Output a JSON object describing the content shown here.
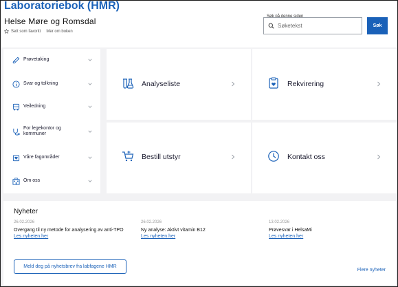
{
  "header": {
    "site_title": "Laboratoriebok (HMR)",
    "org_name": "Helse Møre og Romsdal",
    "favorite_label": "Sett som favoritt",
    "about_label": "Mer om boken"
  },
  "search": {
    "label": "Søk på denne siden",
    "placeholder": "Søketekst",
    "value": "",
    "button_label": "Søk"
  },
  "sidebar": {
    "items": [
      {
        "label": "Prøvetaking",
        "icon": "test-tube-icon"
      },
      {
        "label": "Svar og tolkning",
        "icon": "info-icon"
      },
      {
        "label": "Veiledning",
        "icon": "bus-icon"
      },
      {
        "label": "For legekontor og kommuner",
        "icon": "stethoscope-icon"
      },
      {
        "label": "Våre fagområder",
        "icon": "hand-heart-icon"
      },
      {
        "label": "Om oss",
        "icon": "building-icon"
      }
    ]
  },
  "cards": [
    {
      "label": "Analyseliste",
      "icon": "lab-flask-icon"
    },
    {
      "label": "Rekvirering",
      "icon": "requisition-icon"
    },
    {
      "label": "Bestill utstyr",
      "icon": "cart-icon"
    },
    {
      "label": "Kontakt oss",
      "icon": "clock-icon"
    }
  ],
  "news": {
    "heading": "Nyheter",
    "items": [
      {
        "date": "26.02.2026",
        "title": "Overgang til ny metode for analysering av anti-TPO",
        "link": "Les nyheten her"
      },
      {
        "date": "26.02.2026",
        "title": "Ny analyse: Aktivt vitamin B12",
        "link": "Les nyheten her"
      },
      {
        "date": "13.02.2026",
        "title": "Prøvesvar i HelsaMi",
        "link": "Les nyheten her"
      }
    ],
    "subscribe_label": "Meld deg på nyhetsbrev fra labfagene HMR",
    "more_label": "Flere nyheter"
  },
  "colors": {
    "accent": "#1a61b8",
    "background": "#f2f2f4",
    "text": "#1b1b2f"
  }
}
